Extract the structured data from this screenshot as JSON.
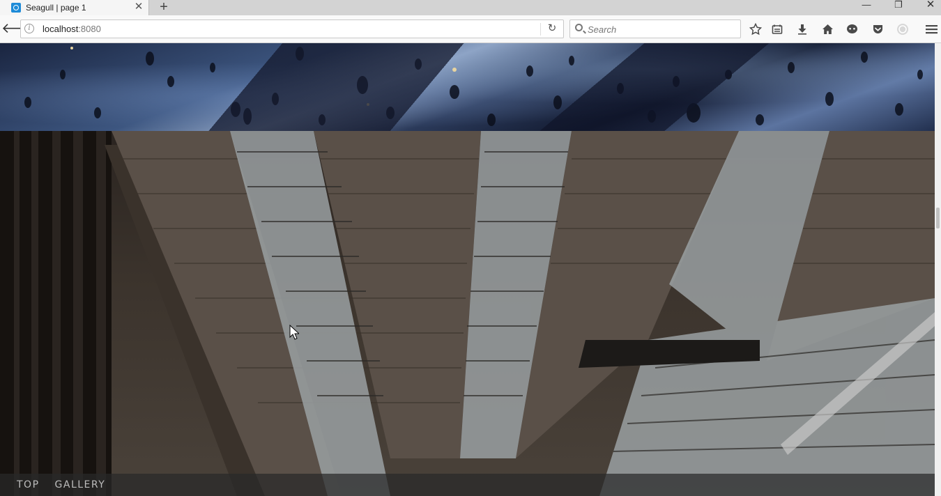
{
  "browser": {
    "tab": {
      "title": "Seagull | page 1"
    },
    "url": {
      "host": "localhost",
      "port": ":8080"
    },
    "search": {
      "placeholder": "Search"
    },
    "toolbar_icons": [
      "bookmark-star-icon",
      "reading-list-icon",
      "download-icon",
      "home-icon",
      "chat-icon",
      "pocket-icon",
      "account-icon",
      "menu-icon"
    ]
  },
  "page": {
    "hero_top": {
      "description_icon": "rain-photo"
    },
    "hero_main": {
      "description_icon": "atrium-photo"
    },
    "nav": {
      "items": [
        {
          "label": "TOP"
        },
        {
          "label": "GALLERY"
        }
      ]
    }
  },
  "colors": {
    "tab_active": "#f5f5f5",
    "tabstrip": "#d3d3d3",
    "navbar": "#f9f9f9",
    "nav_overlay": "#282828",
    "nav_text": "#bdbdbd"
  }
}
